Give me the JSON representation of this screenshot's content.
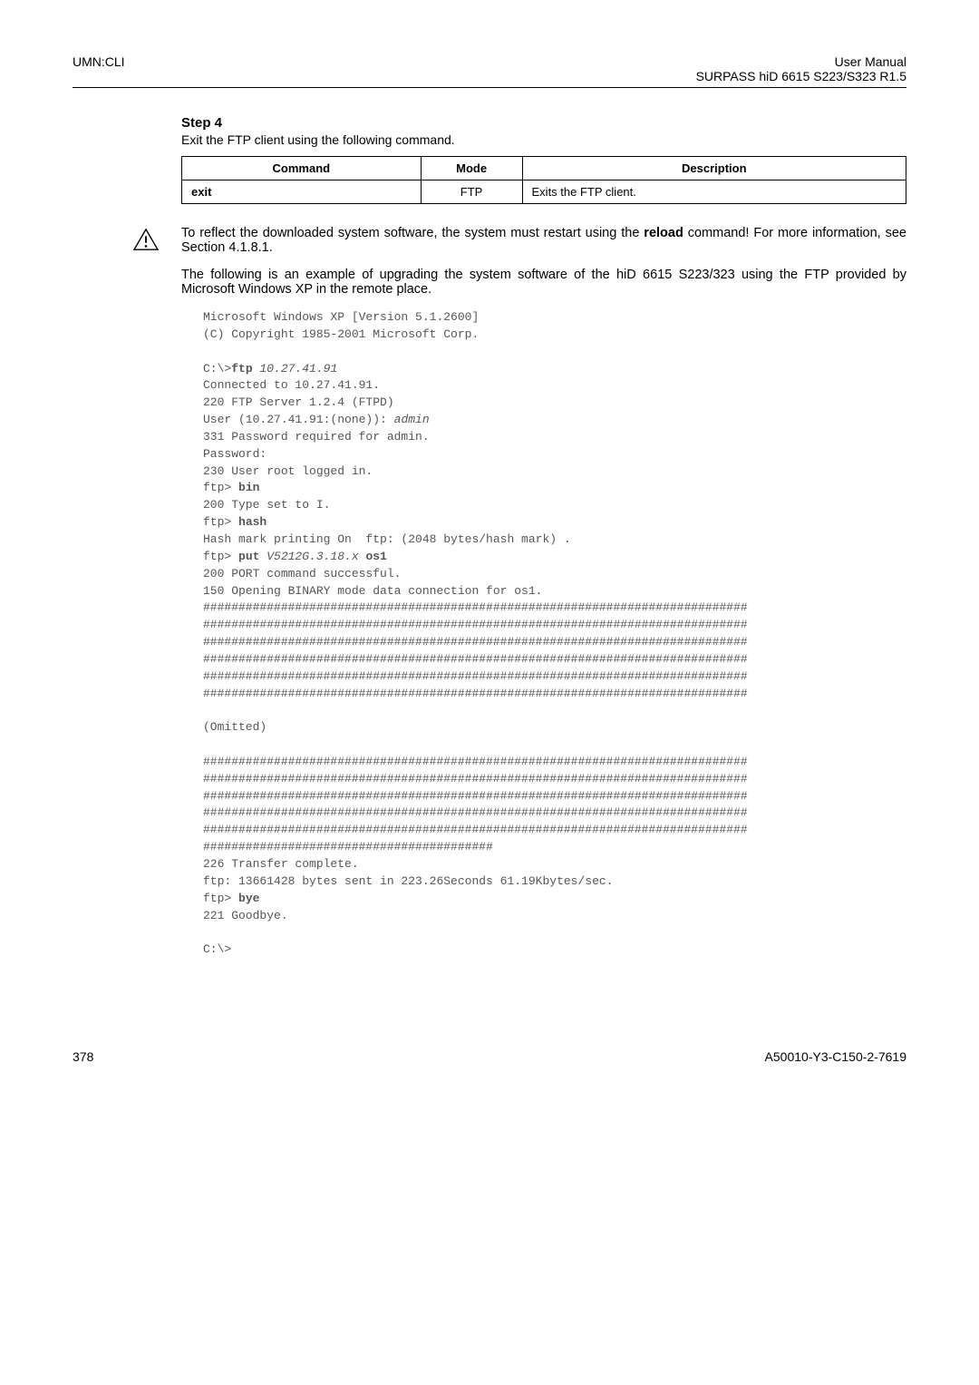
{
  "header": {
    "left": "UMN:CLI",
    "right_line1": "User Manual",
    "right_line2": "SURPASS hiD 6615 S223/S323 R1.5"
  },
  "step": {
    "title": "Step 4",
    "desc": "Exit the FTP client using the following command."
  },
  "table": {
    "headers": {
      "c1": "Command",
      "c2": "Mode",
      "c3": "Description"
    },
    "row": {
      "c1": "exit",
      "c2": "FTP",
      "c3": "Exits the FTP client."
    }
  },
  "note": {
    "line1a": "To reflect the downloaded system software, the system must restart using the ",
    "line1b": "reload",
    "line2": " command! For more information, see Section 4.1.8.1."
  },
  "para": "The following is an example of upgrading the system software of the hiD 6615 S223/323 using the FTP provided by Microsoft Windows XP in the remote place.",
  "term": {
    "l1": "Microsoft Windows XP [Version 5.1.2600]",
    "l2": "(C) Copyright 1985-2001 Microsoft Corp.",
    "l3a": "C:\\>",
    "l3b": "ftp",
    "l3c": " 10.27.41.91",
    "l4": "Connected to 10.27.41.91.",
    "l5": "220 FTP Server 1.2.4 (FTPD)",
    "l6a": "User (10.27.41.91:(none)): ",
    "l6b": "admin",
    "l7": "331 Password required for admin.",
    "l8": "Password:",
    "l9": "230 User root logged in.",
    "l10a": "ftp> ",
    "l10b": "bin",
    "l11": "200 Type set to I.",
    "l12a": "ftp> ",
    "l12b": "hash",
    "l13": "Hash mark printing On  ftp: (2048 bytes/hash mark) .",
    "l14a": "ftp> ",
    "l14b": "put",
    "l14c": " V5212G.3.18.x ",
    "l14d": "os1",
    "l15": "200 PORT command successful.",
    "l16": "150 Opening BINARY mode data connection for os1.",
    "hash": "#############################################################################",
    "omit": "(Omitted)",
    "hashshort": "#########################################",
    "l17": "226 Transfer complete.",
    "l18": "ftp: 13661428 bytes sent in 223.26Seconds 61.19Kbytes/sec.",
    "l19a": "ftp> ",
    "l19b": "bye",
    "l20": "221 Goodbye.",
    "l21": "C:\\>"
  },
  "footer": {
    "left": "378",
    "right": "A50010-Y3-C150-2-7619"
  }
}
